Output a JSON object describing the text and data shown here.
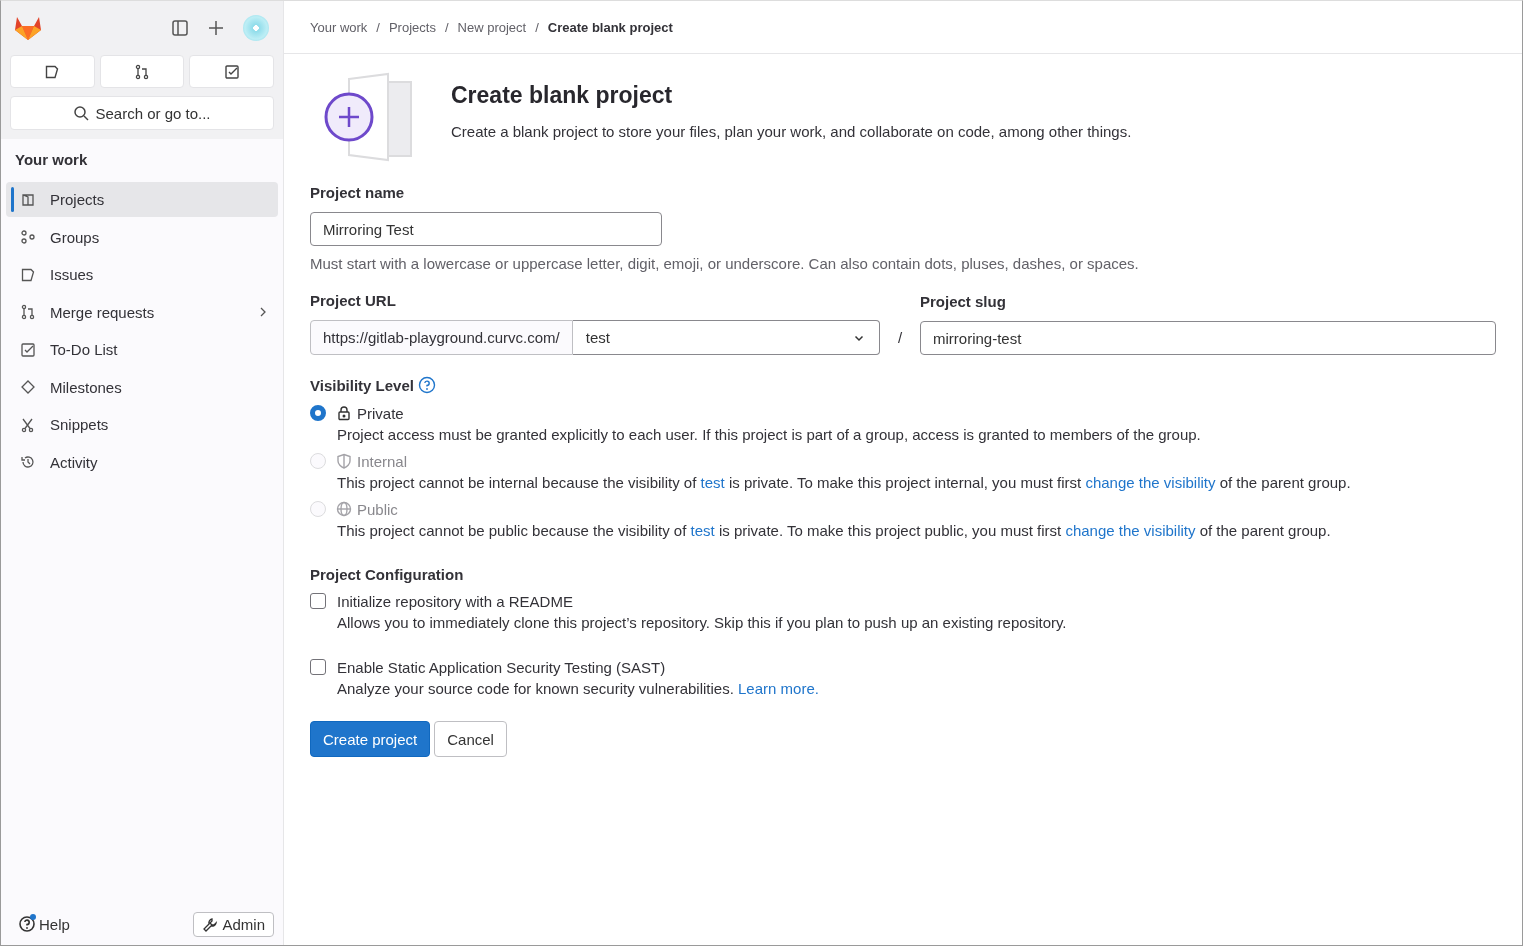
{
  "sidebar": {
    "search": {
      "placeholder": "Search or go to..."
    },
    "section_title": "Your work",
    "items": [
      {
        "label": "Projects",
        "selected": true,
        "expandable": false
      },
      {
        "label": "Groups",
        "selected": false,
        "expandable": false
      },
      {
        "label": "Issues",
        "selected": false,
        "expandable": false
      },
      {
        "label": "Merge requests",
        "selected": false,
        "expandable": true
      },
      {
        "label": "To-Do List",
        "selected": false,
        "expandable": false
      },
      {
        "label": "Milestones",
        "selected": false,
        "expandable": false
      },
      {
        "label": "Snippets",
        "selected": false,
        "expandable": false
      },
      {
        "label": "Activity",
        "selected": false,
        "expandable": false
      }
    ],
    "help": {
      "label": "Help",
      "notification": true
    },
    "admin_button": "Admin"
  },
  "breadcrumbs": [
    {
      "label": "Your work",
      "separator": "/"
    },
    {
      "label": "Projects",
      "separator": "/"
    },
    {
      "label": "New project",
      "separator": "/"
    },
    {
      "label": "Create blank project"
    }
  ],
  "header": {
    "title": "Create blank project",
    "description": "Create a blank project to store your files, plan your work, and collaborate on code, among other things."
  },
  "project_name": {
    "label": "Project name",
    "value": "Mirroring Test",
    "hint": "Must start with a lowercase or uppercase letter, digit, emoji, or underscore. Can also contain dots, pluses, dashes, or spaces."
  },
  "project_url": {
    "label": "Project URL",
    "prefix": "https://gitlab-playground.curvc.com/",
    "namespace": "test",
    "separator": "/"
  },
  "project_slug": {
    "label": "Project slug",
    "value": "mirroring-test"
  },
  "visibility": {
    "label": "Visibility Level",
    "options": [
      {
        "label": "Private",
        "selected": true,
        "disabled": false,
        "description": [
          {
            "kind": "text",
            "text": "Project access must be granted explicitly to each user. If this project is part of a group, access is granted to members of the group."
          }
        ]
      },
      {
        "label": "Internal",
        "selected": false,
        "disabled": true,
        "description": [
          {
            "kind": "text",
            "text": "This project cannot be internal because the visibility of "
          },
          {
            "kind": "link",
            "text": "test"
          },
          {
            "kind": "text",
            "text": " is private. To make this project internal, you must first "
          },
          {
            "kind": "link",
            "text": "change the visibility"
          },
          {
            "kind": "text",
            "text": " of the parent group."
          }
        ]
      },
      {
        "label": "Public",
        "selected": false,
        "disabled": true,
        "description": [
          {
            "kind": "text",
            "text": "This project cannot be public because the visibility of "
          },
          {
            "kind": "link",
            "text": "test"
          },
          {
            "kind": "text",
            "text": " is private. To make this project public, you must first "
          },
          {
            "kind": "link",
            "text": "change the visibility"
          },
          {
            "kind": "text",
            "text": " of the parent group."
          }
        ]
      }
    ]
  },
  "configuration": {
    "title": "Project Configuration",
    "options": [
      {
        "label": "Initialize repository with a README",
        "checked": false,
        "description": [
          {
            "kind": "text",
            "text": "Allows you to immediately clone this project’s repository. Skip this if you plan to push up an existing repository."
          }
        ]
      },
      {
        "label": "Enable Static Application Security Testing (SAST)",
        "checked": false,
        "description": [
          {
            "kind": "text",
            "text": "Analyze your source code for known security vulnerabilities. "
          },
          {
            "kind": "link",
            "text": "Learn more."
          }
        ]
      }
    ]
  },
  "buttons": {
    "primary": "Create project",
    "secondary": "Cancel"
  }
}
